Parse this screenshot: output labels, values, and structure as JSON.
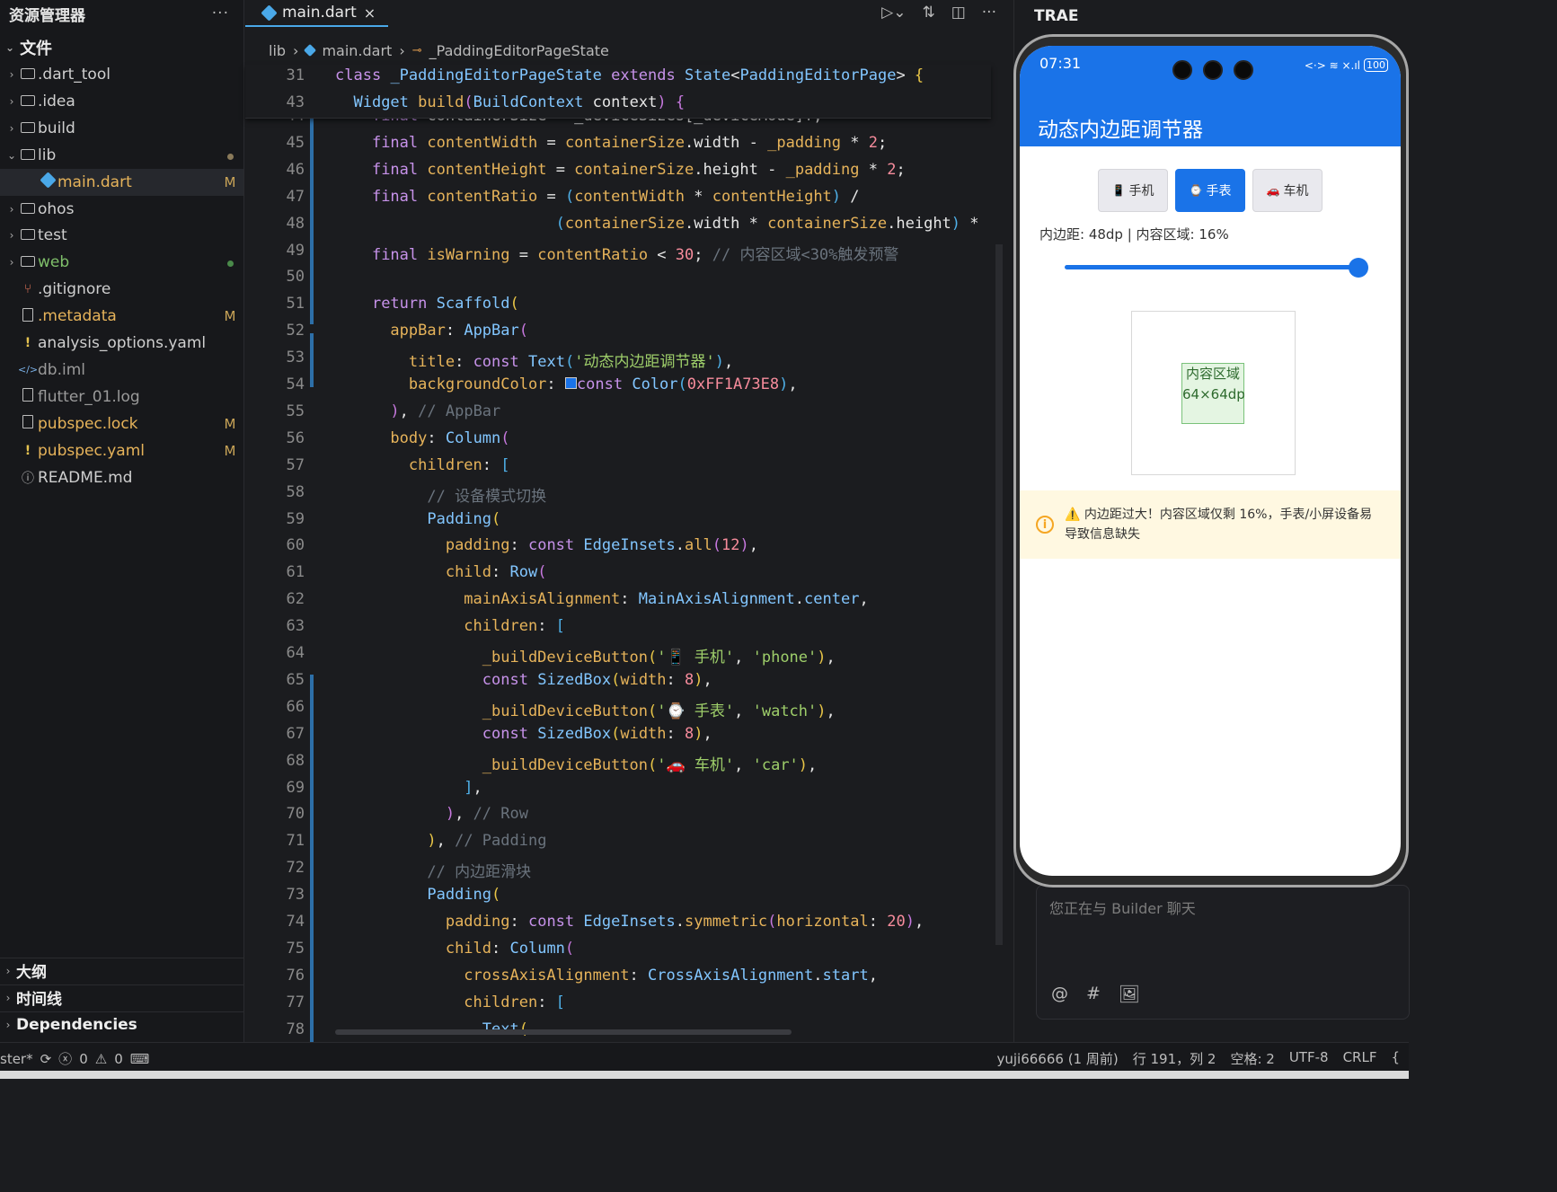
{
  "explorer": {
    "title": "资源管理器",
    "more": "···",
    "section": "文件",
    "items": [
      {
        "name": ".dart_tool",
        "type": "folder",
        "status": "",
        "color": "#cfcfcf"
      },
      {
        "name": ".idea",
        "type": "folder",
        "status": "",
        "color": "#cfcfcf"
      },
      {
        "name": "build",
        "type": "folder",
        "status": "",
        "color": "#cfcfcf"
      },
      {
        "name": "lib",
        "type": "folder-open",
        "status": "dot",
        "color": "#cfcfcf"
      },
      {
        "name": "main.dart",
        "type": "dart",
        "status": "M",
        "color": "#e6b35a"
      },
      {
        "name": "ohos",
        "type": "folder",
        "status": "",
        "color": "#cfcfcf"
      },
      {
        "name": "test",
        "type": "folder",
        "status": "",
        "color": "#cfcfcf"
      },
      {
        "name": "web",
        "type": "folder",
        "status": "greendot",
        "color": "#7fbf6a"
      },
      {
        "name": ".gitignore",
        "type": "git",
        "status": "",
        "color": "#cfcfcf"
      },
      {
        "name": ".metadata",
        "type": "file",
        "status": "M",
        "color": "#e6b35a"
      },
      {
        "name": "analysis_options.yaml",
        "type": "yaml",
        "status": "",
        "color": "#cfcfcf"
      },
      {
        "name": "db.iml",
        "type": "xml",
        "status": "",
        "color": "#9a9a9a"
      },
      {
        "name": "flutter_01.log",
        "type": "file",
        "status": "",
        "color": "#9a9a9a"
      },
      {
        "name": "pubspec.lock",
        "type": "file",
        "status": "M",
        "color": "#e6b35a"
      },
      {
        "name": "pubspec.yaml",
        "type": "yaml",
        "status": "M",
        "color": "#e6b35a"
      },
      {
        "name": "README.md",
        "type": "info",
        "status": "",
        "color": "#cfcfcf"
      }
    ],
    "bottom": [
      "大纲",
      "时间线",
      "Dependencies"
    ]
  },
  "editor": {
    "tab": "main.dart",
    "tab_close": "×",
    "breadcrumb": [
      "lib",
      "main.dart",
      "_PaddingEditorPageState"
    ],
    "sticky": [
      {
        "n": "31",
        "h": "<span class='kw'>class</span> <span class='ty'>_PaddingEditorPageState</span> <span class='kw'>extends</span> <span class='ty'>State</span>&lt;<span class='ty'>PaddingEditorPage</span>&gt; <span class='br1'>{</span>"
      },
      {
        "n": "43",
        "h": "  <span class='ty'>Widget</span> <span class='fn'>build</span><span class='br2'>(</span><span class='ty'>BuildContext</span> context<span class='br2'>)</span> <span class='br2'>{</span>"
      }
    ],
    "lines": [
      {
        "n": "44",
        "h": "    <span class='kw'>final</span> containerSize = _deviceSizes[_deviceMode]!;"
      },
      {
        "n": "45",
        "h": "    <span class='kw'>final</span> <span class='fn'>contentWidth</span> = <span class='fn'>containerSize</span>.width - <span class='fn'>_padding</span> * <span class='num'>2</span>;"
      },
      {
        "n": "46",
        "h": "    <span class='kw'>final</span> <span class='fn'>contentHeight</span> = <span class='fn'>containerSize</span>.height - <span class='fn'>_padding</span> * <span class='num'>2</span>;"
      },
      {
        "n": "47",
        "h": "    <span class='kw'>final</span> <span class='fn'>contentRatio</span> = <span class='br3'>(</span><span class='fn'>contentWidth</span> * <span class='fn'>contentHeight</span><span class='br3'>)</span> /"
      },
      {
        "n": "48",
        "h": "                        <span class='br3'>(</span><span class='fn'>containerSize</span>.width * <span class='fn'>containerSize</span>.height<span class='br3'>)</span> *"
      },
      {
        "n": "49",
        "h": "    <span class='kw'>final</span> <span class='fn'>isWarning</span> = <span class='fn'>contentRatio</span> &lt; <span class='num'>30</span>; <span class='cm'>// 内容区域&lt;30%触发预警</span>"
      },
      {
        "n": "50",
        "h": ""
      },
      {
        "n": "51",
        "h": "    <span class='kw'>return</span> <span class='ty'>Scaffold</span><span class='br1'>(</span>"
      },
      {
        "n": "52",
        "h": "      <span class='fn'>appBar</span>: <span class='ty'>AppBar</span><span class='br2'>(</span>"
      },
      {
        "n": "53",
        "h": "        <span class='fn'>title</span>: <span class='kw'>const</span> <span class='ty'>Text</span><span class='br3'>(</span><span class='str'>'动态内边距调节器'</span><span class='br3'>)</span>,"
      },
      {
        "n": "54",
        "h": "        <span class='fn'>backgroundColor</span>: <span style='display:inline-block;width:13px;height:13px;background:#1a73e8;border:1px solid #ccc'></span><span class='kw'>const</span> <span class='ty'>Color</span><span class='br3'>(</span><span class='num'>0xFF1A73E8</span><span class='br3'>)</span>,"
      },
      {
        "n": "55",
        "h": "      <span class='br2'>)</span>, <span class='cm'>// AppBar</span>"
      },
      {
        "n": "56",
        "h": "      <span class='fn'>body</span>: <span class='ty'>Column</span><span class='br2'>(</span>"
      },
      {
        "n": "57",
        "h": "        <span class='fn'>children</span>: <span class='br3'>[</span>"
      },
      {
        "n": "58",
        "h": "          <span class='cm'>// 设备模式切换</span>"
      },
      {
        "n": "59",
        "h": "          <span class='ty'>Padding</span><span class='br1'>(</span>"
      },
      {
        "n": "60",
        "h": "            <span class='fn'>padding</span>: <span class='kw'>const</span> <span class='ty'>EdgeInsets</span>.<span class='fn'>all</span><span class='br2'>(</span><span class='num'>12</span><span class='br2'>)</span>,"
      },
      {
        "n": "61",
        "h": "            <span class='fn'>child</span>: <span class='ty'>Row</span><span class='br2'>(</span>"
      },
      {
        "n": "62",
        "h": "              <span class='fn'>mainAxisAlignment</span>: <span class='ty'>MainAxisAlignment</span>.<span class='ty'>center</span>,"
      },
      {
        "n": "63",
        "h": "              <span class='fn'>children</span>: <span class='br3'>[</span>"
      },
      {
        "n": "64",
        "h": "                <span class='fn'>_buildDeviceButton</span><span class='br1'>(</span><span class='str'>'📱 手机'</span>, <span class='str'>'phone'</span><span class='br1'>)</span>,"
      },
      {
        "n": "65",
        "h": "                <span class='kw'>const</span> <span class='ty'>SizedBox</span><span class='br1'>(</span><span class='fn'>width</span>: <span class='num'>8</span><span class='br1'>)</span>,"
      },
      {
        "n": "66",
        "h": "                <span class='fn'>_buildDeviceButton</span><span class='br1'>(</span><span class='str'>'⌚ 手表'</span>, <span class='str'>'watch'</span><span class='br1'>)</span>,"
      },
      {
        "n": "67",
        "h": "                <span class='kw'>const</span> <span class='ty'>SizedBox</span><span class='br1'>(</span><span class='fn'>width</span>: <span class='num'>8</span><span class='br1'>)</span>,"
      },
      {
        "n": "68",
        "h": "                <span class='fn'>_buildDeviceButton</span><span class='br1'>(</span><span class='str'>'🚗 车机'</span>, <span class='str'>'car'</span><span class='br1'>)</span>,"
      },
      {
        "n": "69",
        "h": "              <span class='br3'>]</span>,"
      },
      {
        "n": "70",
        "h": "            <span class='br2'>)</span>, <span class='cm'>// Row</span>"
      },
      {
        "n": "71",
        "h": "          <span class='br1'>)</span>, <span class='cm'>// Padding</span>"
      },
      {
        "n": "72",
        "h": "          <span class='cm'>// 内边距滑块</span>"
      },
      {
        "n": "73",
        "h": "          <span class='ty'>Padding</span><span class='br1'>(</span>"
      },
      {
        "n": "74",
        "h": "            <span class='fn'>padding</span>: <span class='kw'>const</span> <span class='ty'>EdgeInsets</span>.<span class='fn'>symmetric</span><span class='br2'>(</span><span class='fn'>horizontal</span>: <span class='num'>20</span><span class='br2'>)</span>,"
      },
      {
        "n": "75",
        "h": "            <span class='fn'>child</span>: <span class='ty'>Column</span><span class='br2'>(</span>"
      },
      {
        "n": "76",
        "h": "              <span class='fn'>crossAxisAlignment</span>: <span class='ty'>CrossAxisAlignment</span>.<span class='ty'>start</span>,"
      },
      {
        "n": "77",
        "h": "              <span class='fn'>children</span>: <span class='br3'>[</span>"
      },
      {
        "n": "78",
        "h": "                <span class='ty'>Text</span><span class='br1'>(</span>"
      }
    ]
  },
  "right": {
    "title": "TRAE",
    "chat_placeholder": "您正在与 Builder 聊天",
    "tools": [
      "@",
      "#",
      "🖼"
    ]
  },
  "phone": {
    "time": "07:31",
    "signal": "<·> ≋ ×.ıl",
    "battery": "100",
    "title": "动态内边距调节器",
    "buttons": [
      {
        "icon": "📱",
        "label": "手机",
        "active": false
      },
      {
        "icon": "⌚",
        "label": "手表",
        "active": true
      },
      {
        "icon": "🚗",
        "label": "车机",
        "active": false
      }
    ],
    "info": "内边距: 48dp | 内容区域: 16%",
    "slider_value": 1.0,
    "content_label": "内容区域 64×64dp",
    "warning": "⚠️ 内边距过大！内容区域仅剩 16%，手表/小屏设备易导致信息缺失",
    "warning_icon": "i"
  },
  "statusbar": {
    "left_text": "ster*",
    "errors": "0",
    "warnings": "0",
    "right": [
      "yuji66666 (1 周前)",
      "行 191，列 2",
      "空格: 2",
      "UTF-8",
      "CRLF",
      "{"
    ]
  }
}
